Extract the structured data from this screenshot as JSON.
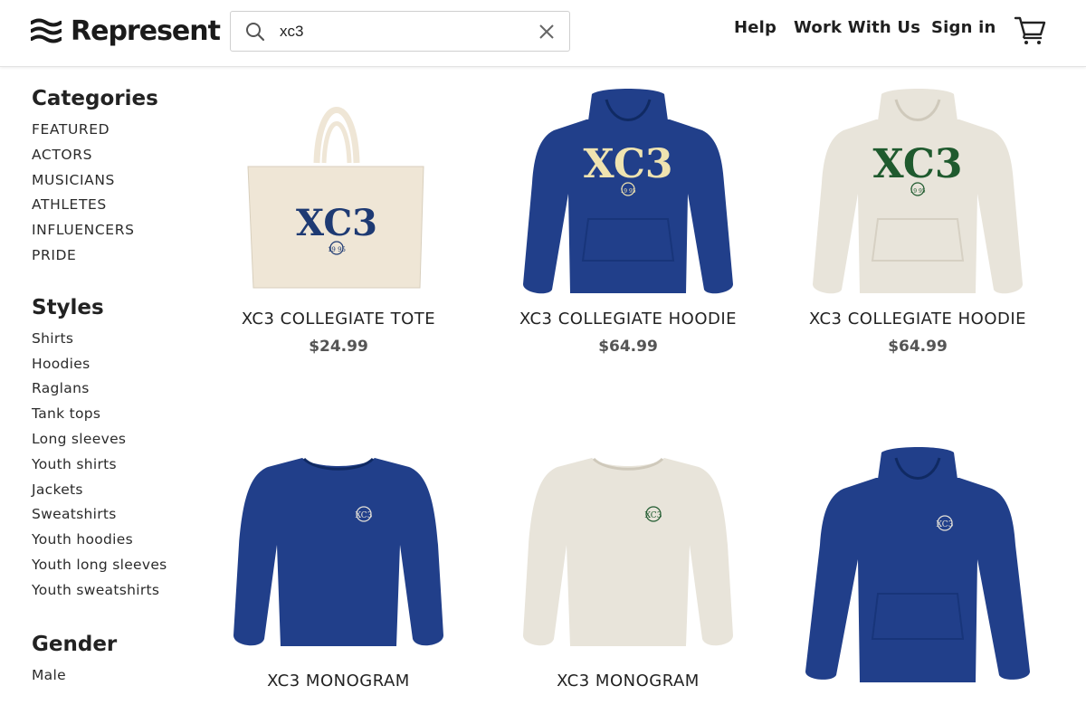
{
  "brand": {
    "name": "Represent"
  },
  "search": {
    "value": "xc3"
  },
  "nav": {
    "help": "Help",
    "work_with_us": "Work With Us",
    "sign_in": "Sign in"
  },
  "sidebar": {
    "categories_title": "Categories",
    "categories": [
      "FEATURED",
      "ACTORS",
      "MUSICIANS",
      "ATHLETES",
      "INFLUENCERS",
      "PRIDE"
    ],
    "styles_title": "Styles",
    "styles": [
      "Shirts",
      "Hoodies",
      "Raglans",
      "Tank tops",
      "Long sleeves",
      "Youth shirts",
      "Jackets",
      "Sweatshirts",
      "Youth hoodies",
      "Youth long sleeves",
      "Youth sweatshirts"
    ],
    "gender_title": "Gender",
    "gender": [
      "Male"
    ]
  },
  "products": [
    {
      "name": "XC3 COLLEGIATE TOTE",
      "price": "$24.99",
      "type": "tote",
      "body_color": "#efe6d6",
      "print_color": "#1e3a73",
      "print_text": "XC3"
    },
    {
      "name": "XC3 COLLEGIATE HOODIE",
      "price": "$64.99",
      "type": "hoodie",
      "body_color": "#213f8a",
      "print_color": "#efe3b0",
      "print_text": "XC3"
    },
    {
      "name": "XC3 COLLEGIATE HOODIE",
      "price": "$64.99",
      "type": "hoodie",
      "body_color": "#e8e4da",
      "print_color": "#1f5a2e",
      "print_text": "XC3"
    },
    {
      "name": "XC3 MONOGRAM",
      "price": "",
      "type": "crewneck",
      "body_color": "#213f8a",
      "print_color": "#e8e4da",
      "print_text": "XC3"
    },
    {
      "name": "XC3 MONOGRAM",
      "price": "",
      "type": "crewneck",
      "body_color": "#e8e4da",
      "print_color": "#1f5a2e",
      "print_text": "XC3"
    },
    {
      "name": "",
      "price": "",
      "type": "hoodie-small",
      "body_color": "#213f8a",
      "print_color": "#e8e4da",
      "print_text": "XC3"
    }
  ]
}
